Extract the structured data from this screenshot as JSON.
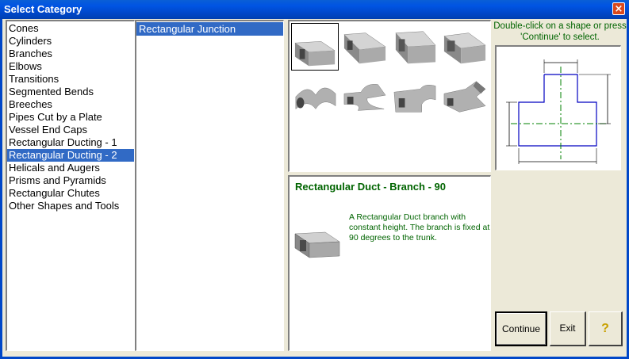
{
  "window": {
    "title": "Select Category",
    "close_glyph": "×"
  },
  "categories": [
    {
      "label": "Cones",
      "selected": false
    },
    {
      "label": "Cylinders",
      "selected": false
    },
    {
      "label": "Branches",
      "selected": false
    },
    {
      "label": "Elbows",
      "selected": false
    },
    {
      "label": "Transitions",
      "selected": false
    },
    {
      "label": "Segmented Bends",
      "selected": false
    },
    {
      "label": "Breeches",
      "selected": false
    },
    {
      "label": "Pipes Cut by a Plate",
      "selected": false
    },
    {
      "label": "Vessel End Caps",
      "selected": false
    },
    {
      "label": "Rectangular Ducting - 1",
      "selected": false
    },
    {
      "label": "Rectangular Ducting - 2",
      "selected": true
    },
    {
      "label": "Helicals and Augers",
      "selected": false
    },
    {
      "label": "Prisms and Pyramids",
      "selected": false
    },
    {
      "label": "Rectangular Chutes",
      "selected": false
    },
    {
      "label": "Other Shapes and Tools",
      "selected": false
    }
  ],
  "subcategories": [
    {
      "label": "Rectangular Junction",
      "selected": true
    }
  ],
  "shapes": [
    {
      "icon": "rect-branch-90-icon",
      "selected": true
    },
    {
      "icon": "rect-branch-angled-icon",
      "selected": false
    },
    {
      "icon": "rect-branch-offset-icon",
      "selected": false
    },
    {
      "icon": "rect-branch-tapered-icon",
      "selected": false
    },
    {
      "icon": "rect-breeches-y-icon",
      "selected": false
    },
    {
      "icon": "rect-breeches-curved-icon",
      "selected": false
    },
    {
      "icon": "rect-branch-curved-icon",
      "selected": false
    },
    {
      "icon": "rect-branch-swept-icon",
      "selected": false
    }
  ],
  "description": {
    "title": "Rectangular Duct - Branch - 90",
    "text": "A Rectangular Duct branch with constant height. The branch is fixed at 90 degrees to the trunk."
  },
  "hint": "Double-click on a shape or press 'Continue' to select.",
  "buttons": {
    "continue": "Continue",
    "exit": "Exit",
    "help_glyph": "?"
  },
  "colors": {
    "title_bar": "#0054e3",
    "selection": "#316AC5",
    "hint_text": "#006400",
    "diagram_outline": "#0000c0",
    "diagram_centerline": "#008000"
  }
}
